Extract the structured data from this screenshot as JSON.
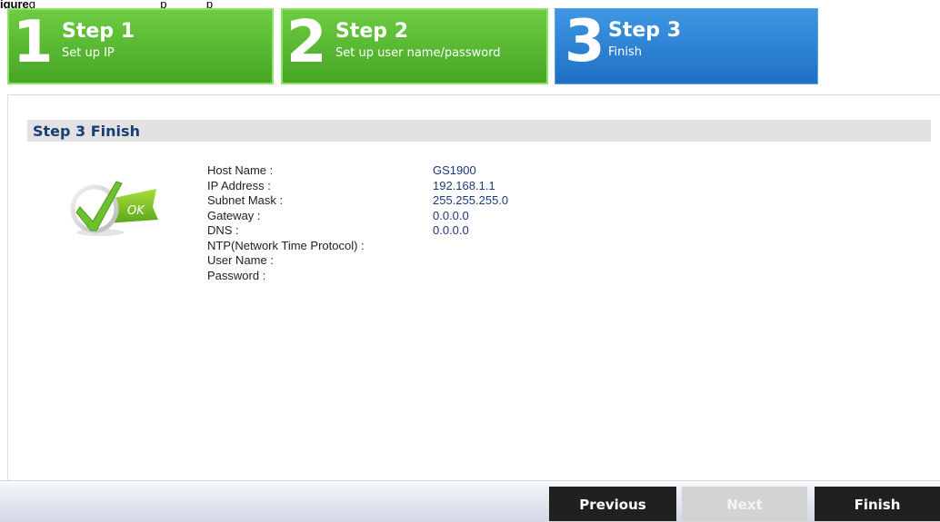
{
  "caption": {
    "figure_label": "igure",
    "text": "g                                      p            p"
  },
  "steps": [
    {
      "number": "1",
      "title": "Step 1",
      "subtitle": "Set up IP",
      "state": "done"
    },
    {
      "number": "2",
      "title": "Step 2",
      "subtitle": "Set up user name/password",
      "state": "done"
    },
    {
      "number": "3",
      "title": "Step 3",
      "subtitle": "Finish",
      "state": "active"
    }
  ],
  "section": {
    "title": "Step 3 Finish"
  },
  "ok_icon": {
    "text": "OK",
    "icon": "ok-check-icon"
  },
  "summary": [
    {
      "label": "Host Name :",
      "value": "GS1900"
    },
    {
      "label": "IP Address :",
      "value": "192.168.1.1"
    },
    {
      "label": "Subnet Mask :",
      "value": "255.255.255.0"
    },
    {
      "label": "Gateway :",
      "value": "0.0.0.0"
    },
    {
      "label": "DNS :",
      "value": "0.0.0.0"
    },
    {
      "label": "NTP(Network Time Protocol) :",
      "value": ""
    },
    {
      "label": "User Name :",
      "value": ""
    },
    {
      "label": "Password :",
      "value": ""
    }
  ],
  "buttons": {
    "previous": "Previous",
    "next": "Next",
    "finish": "Finish"
  },
  "colors": {
    "step_done": "#52b22e",
    "step_active": "#2a7fd4",
    "section_title": "#163f74",
    "button_dark": "#202020",
    "button_disabled": "#d3d3d3"
  }
}
